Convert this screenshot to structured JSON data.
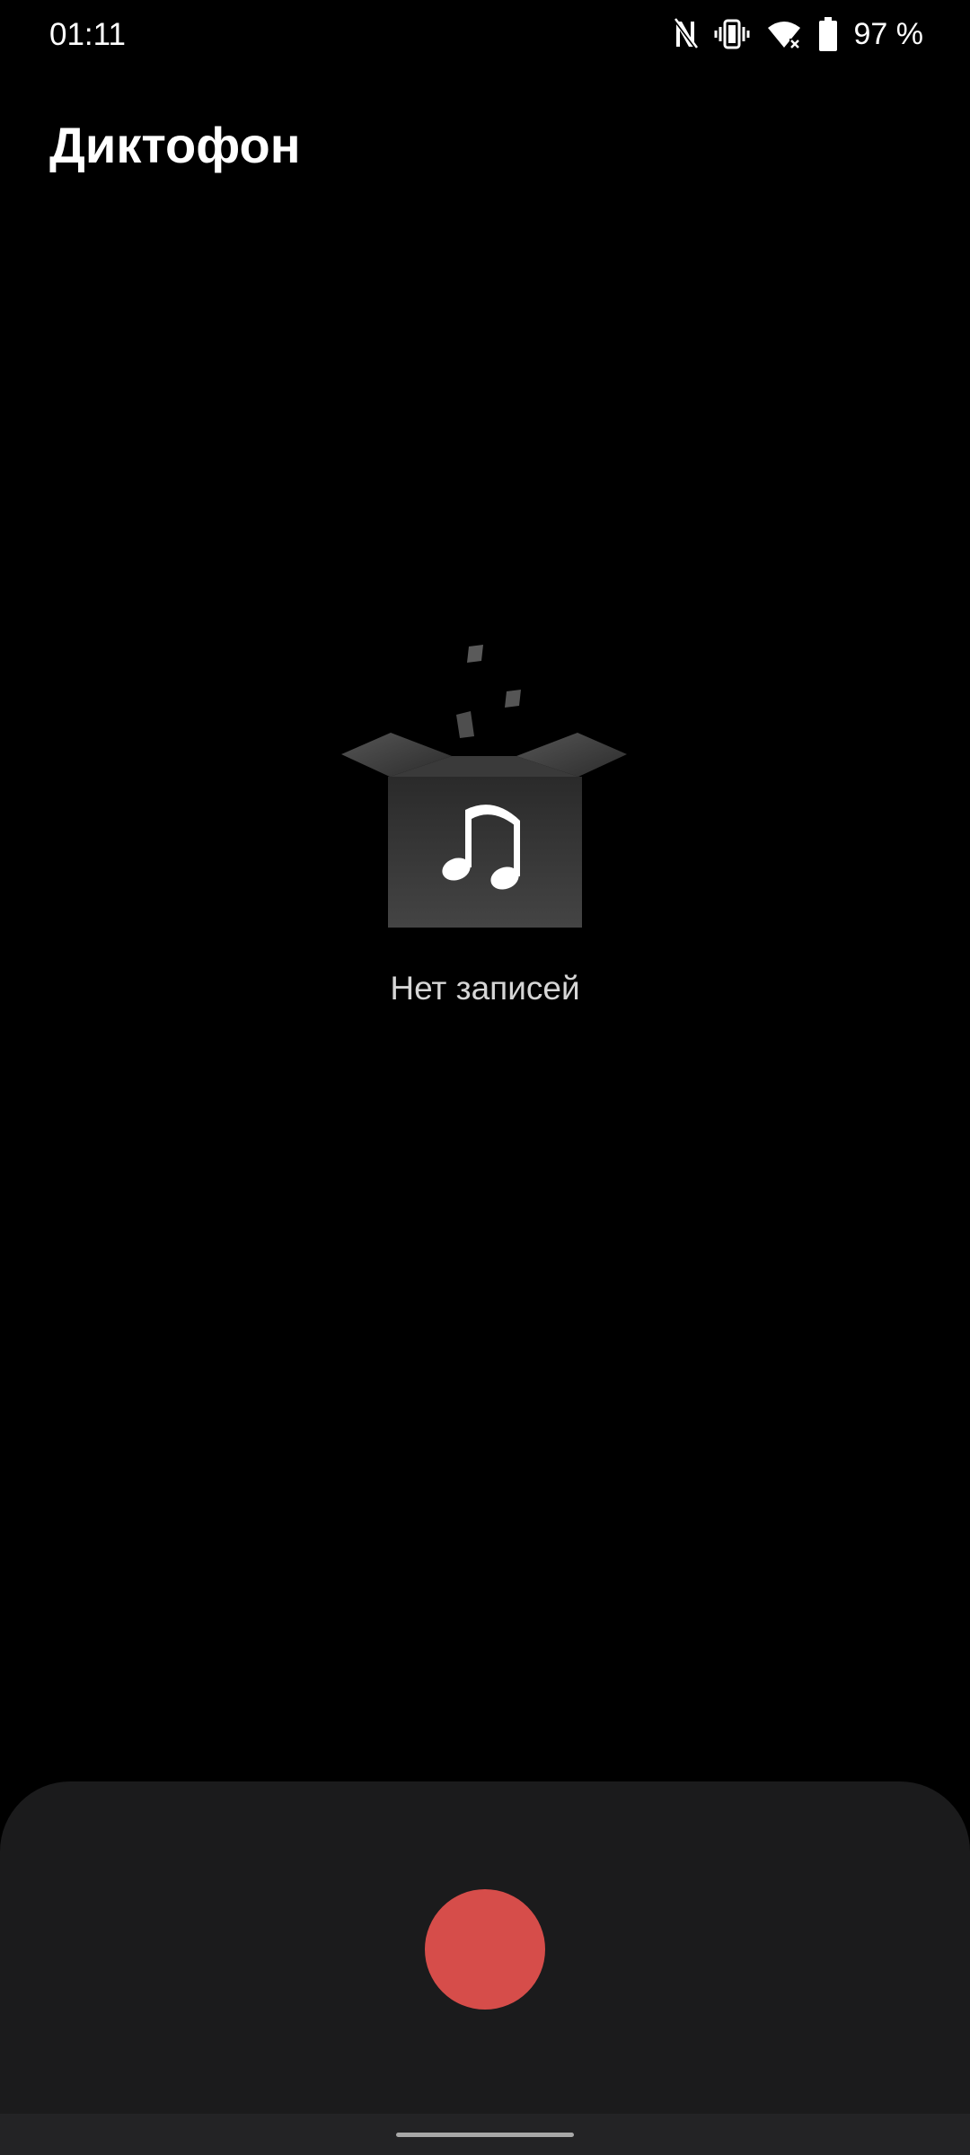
{
  "status_bar": {
    "time": "01:11",
    "battery_percent": "97 %",
    "icons": [
      "nfc-icon",
      "vibrate-icon",
      "wifi-icon",
      "battery-icon"
    ]
  },
  "header": {
    "title": "Диктофон"
  },
  "empty_state": {
    "message": "Нет записей",
    "illustration": "open-box-music-note-icon"
  },
  "recorder": {
    "record_button_icon": "record-icon",
    "record_color": "#d64d4a"
  },
  "colors": {
    "background": "#000000",
    "panel": "#1b1b1c",
    "nav_bar": "#232325"
  }
}
